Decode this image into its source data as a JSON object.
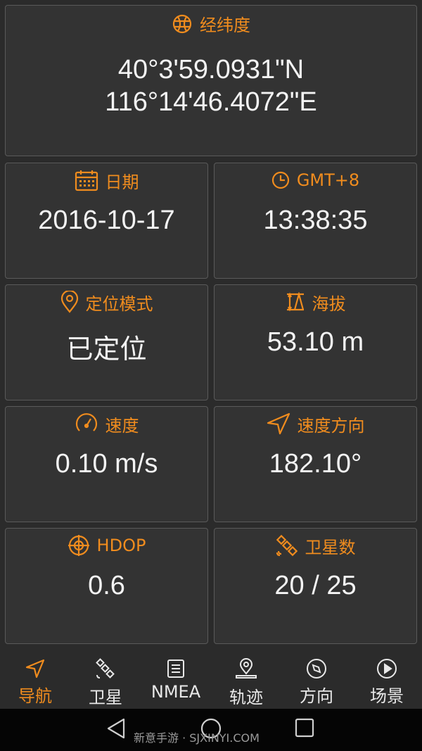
{
  "coordinates": {
    "title": "经纬度",
    "latitude": "40°3'59.0931\"N",
    "longitude": "116°14'46.4072\"E"
  },
  "cards": {
    "date": {
      "label": "日期",
      "value": "2016-10-17"
    },
    "timezone": {
      "label": "GMT+8",
      "value": "13:38:35"
    },
    "fix_mode": {
      "label": "定位模式",
      "value": "已定位"
    },
    "altitude": {
      "label": "海拔",
      "value": "53.10 m"
    },
    "speed": {
      "label": "速度",
      "value": "0.10 m/s"
    },
    "bearing": {
      "label": "速度方向",
      "value": "182.10°"
    },
    "hdop": {
      "label": "HDOP",
      "value": "0.6"
    },
    "satellites": {
      "label": "卫星数",
      "value": "20 / 25"
    }
  },
  "nav": {
    "items": [
      {
        "label": "导航",
        "icon": "navigation-arrow-icon",
        "active": true
      },
      {
        "label": "卫星",
        "icon": "satellite-icon",
        "active": false
      },
      {
        "label": "NMEA",
        "icon": "document-icon",
        "active": false
      },
      {
        "label": "轨迹",
        "icon": "location-pin-icon",
        "active": false
      },
      {
        "label": "方向",
        "icon": "compass-icon",
        "active": false
      },
      {
        "label": "场景",
        "icon": "play-icon",
        "active": false
      }
    ]
  },
  "watermark": "新意手游 · SJXINYI.COM",
  "colors": {
    "accent": "#f08c1e",
    "background": "#2b2b2b",
    "card": "#333333",
    "card_border": "#5a5a5a"
  }
}
